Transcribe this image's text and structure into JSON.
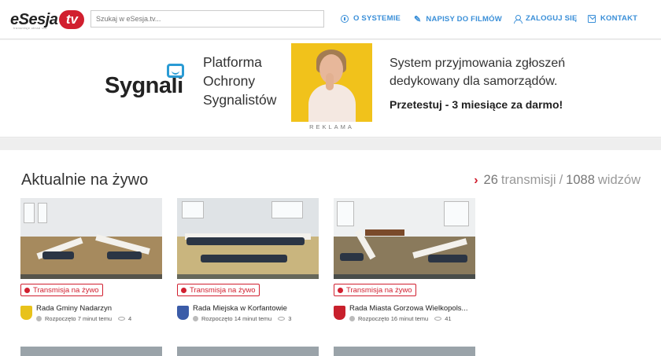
{
  "header": {
    "logo_text": "eSesja",
    "logo_badge": "tv",
    "logo_sub": "transmisje obrad rad",
    "search_placeholder": "Szukaj w eSesja.tv...",
    "nav": [
      {
        "label": "O SYSTEMIE",
        "icon": "info-icon"
      },
      {
        "label": "NAPISY DO FILMÓW",
        "icon": "subtitles-icon"
      },
      {
        "label": "ZALOGUJ SIĘ",
        "icon": "user-icon"
      },
      {
        "label": "KONTAKT",
        "icon": "mail-icon"
      }
    ]
  },
  "ad": {
    "brand": "Sygnali",
    "tagline": "Platforma Ochrony Sygnalistów",
    "label": "REKLAMA",
    "description": "System przyjmowania zgłoszeń dedykowany dla samorządów.",
    "cta": "Przetestuj - 3 miesiące za darmo!"
  },
  "live": {
    "title": "Aktualnie na żywo",
    "transmissions_count": "26",
    "transmissions_label": "transmisji",
    "separator": "/",
    "viewers_count": "1088",
    "viewers_label": "widzów",
    "cards": [
      {
        "badge": "Transmisja na żywo",
        "name": "Rada Gminy Nadarzyn",
        "started": "Rozpoczęto 7 minut temu",
        "viewers": "4",
        "crest_color": "#e8c21a"
      },
      {
        "badge": "Transmisja na żywo",
        "name": "Rada Miejska w Korfantowie",
        "started": "Rozpoczęto 14 minut temu",
        "viewers": "3",
        "crest_color": "#3b5ca8"
      },
      {
        "badge": "Transmisja na żywo",
        "name": "Rada Miasta Gorzowa Wielkopols...",
        "started": "Rozpoczęto 16 minut temu",
        "viewers": "41",
        "crest_color": "#c8202c"
      }
    ]
  },
  "colors": {
    "accent": "#d11f2f",
    "nav": "#3a8fd8",
    "ad_photo_bg": "#f1c21b"
  }
}
